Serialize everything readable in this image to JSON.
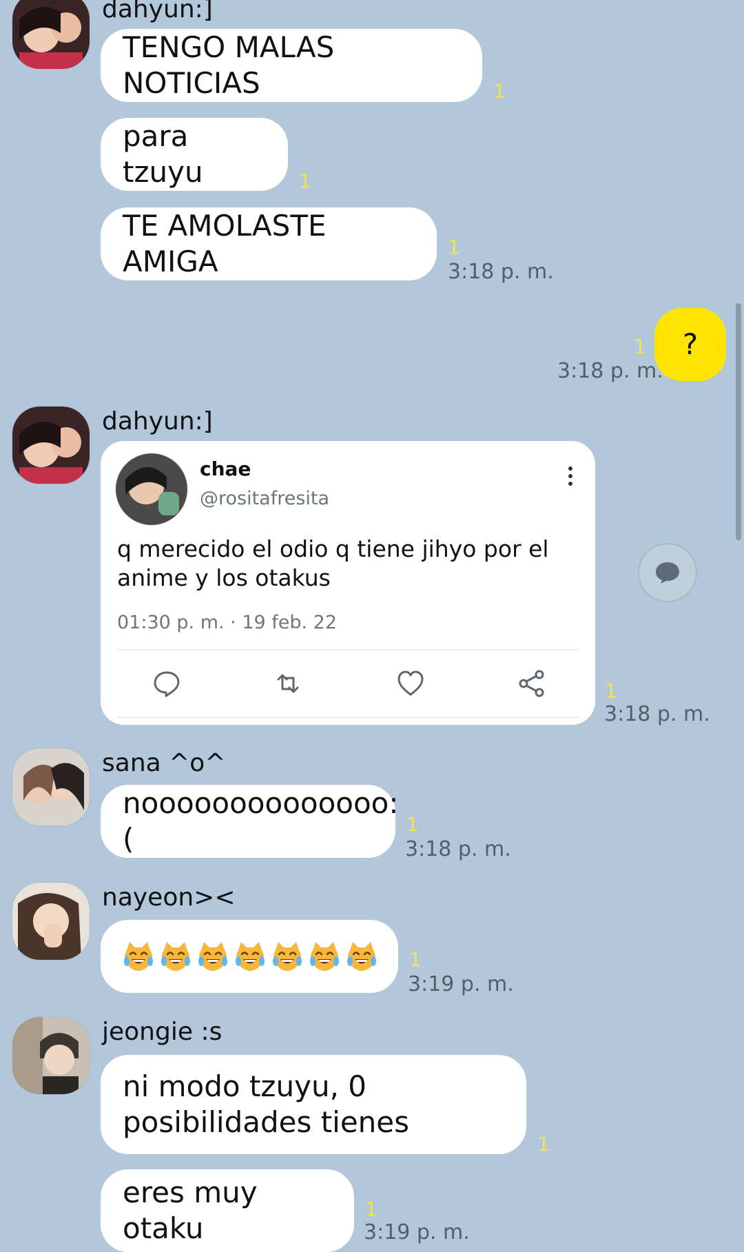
{
  "colors": {
    "background": "#b2c7da",
    "bubble_in": "#ffffff",
    "bubble_out": "#fee500",
    "unread": "#f5e34e",
    "time": "#555e66"
  },
  "messages": [
    {
      "sender": "dahyun:]",
      "texts": [
        "TENGO MALAS NOTICIAS",
        "para tzuyu",
        "TE AMOLASTE AMIGA"
      ],
      "unread": [
        "1",
        "1",
        "1"
      ],
      "time": "3:18 p. m."
    },
    {
      "outgoing": true,
      "text": "?",
      "unread": "1",
      "time": "3:18 p. m."
    },
    {
      "sender": "dahyun:]",
      "tweet": {
        "name": "chae",
        "handle": "@rositafresita",
        "text_line1": "q merecido el odio q tiene jihyo por el",
        "text_line2": "anime y los otakus",
        "date": "01:30 p. m. · 19 feb. 22"
      },
      "unread": "1",
      "time": "3:18 p. m."
    },
    {
      "sender": "sana ^o^",
      "text": "noooooooooooooo:(",
      "unread": "1",
      "time": "3:18 p. m."
    },
    {
      "sender": "nayeon><",
      "emoji": "crying-laughing-cat",
      "emoji_count": 7,
      "unread": "1",
      "time": "3:19 p. m."
    },
    {
      "sender": "jeongie :s",
      "text_line1": "ni modo tzuyu, 0",
      "text_line2": "posibilidades tienes",
      "text2": "eres muy otaku",
      "unread": [
        "1",
        "1"
      ],
      "time": "3:19 p. m."
    }
  ],
  "icons": {
    "tweet_actions": [
      "reply-icon",
      "retweet-icon",
      "like-icon",
      "share-icon"
    ],
    "menu": "more-vertical-icon",
    "floating": "chat-bubble-icon"
  }
}
